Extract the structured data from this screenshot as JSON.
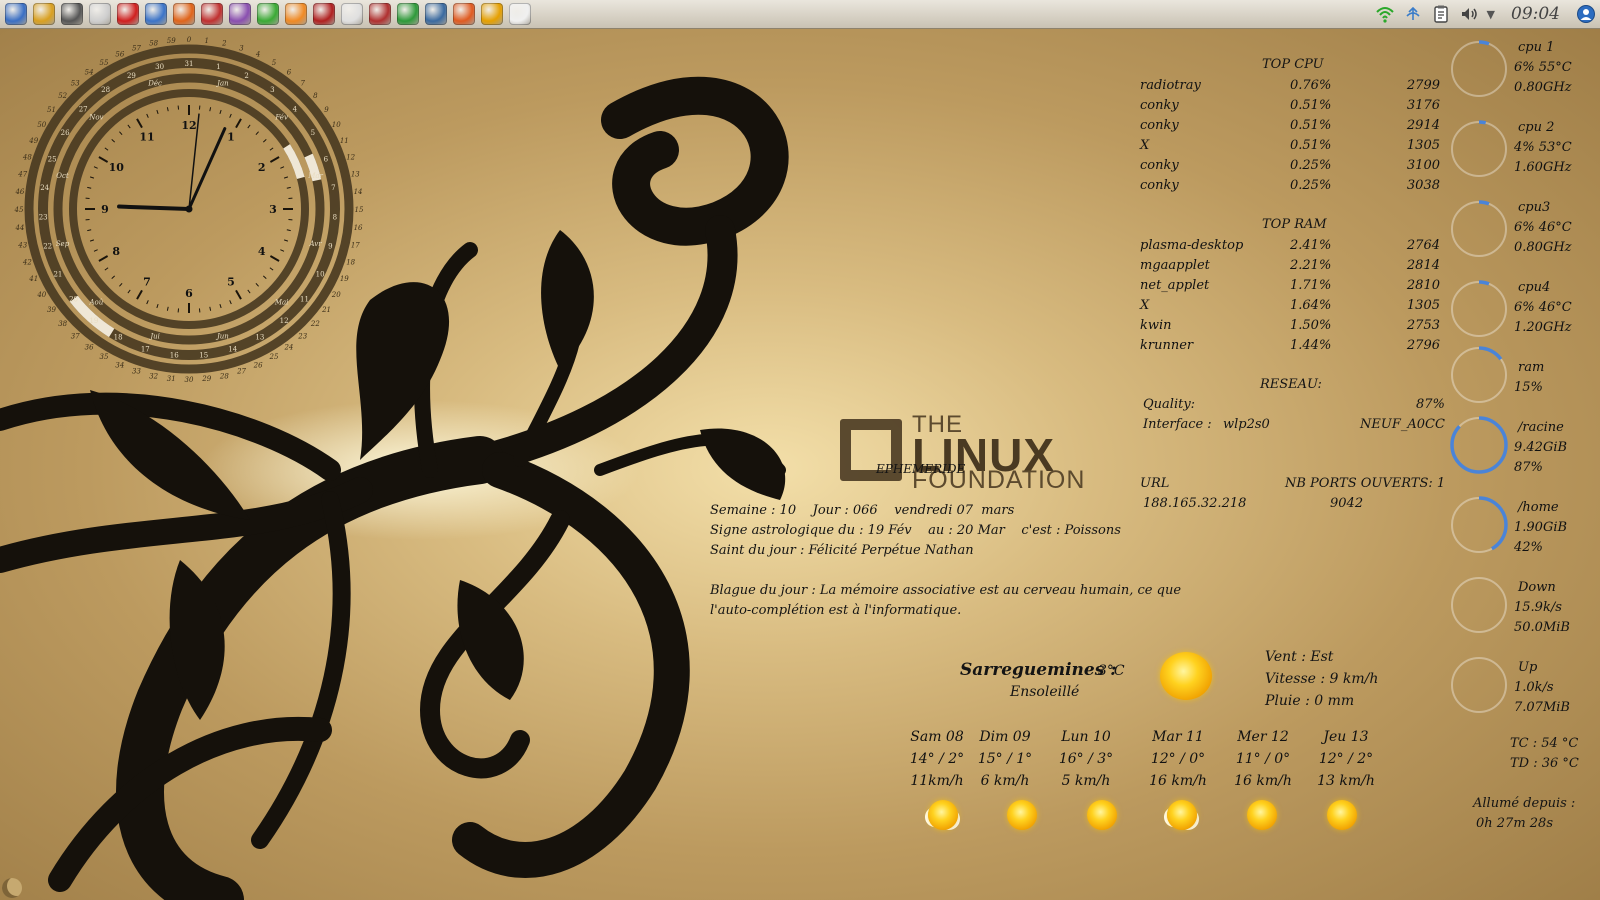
{
  "panel": {
    "clock": "09:04",
    "launchers": [
      {
        "icon": "kde-menu-icon",
        "color": "#3a6fc4"
      },
      {
        "icon": "network-people-icon",
        "color": "#d9a020"
      },
      {
        "icon": "settings-tools-icon",
        "color": "#555555"
      },
      {
        "icon": "file-manager-icon",
        "color": "#cfcfcf"
      },
      {
        "icon": "opera-browser-icon",
        "color": "#d01f1f"
      },
      {
        "icon": "kde-bird-icon",
        "color": "#3c74c8"
      },
      {
        "icon": "firefox-icon",
        "color": "#e0641a"
      },
      {
        "icon": "rss-reader-icon",
        "color": "#c03030"
      },
      {
        "icon": "media-disc-icon",
        "color": "#8a4fb0"
      },
      {
        "icon": "media-player-icon",
        "color": "#3aaa35"
      },
      {
        "icon": "grid-app-icon",
        "color": "#f08a24"
      },
      {
        "icon": "dictionary-icon",
        "color": "#b02020"
      },
      {
        "icon": "phone-app-icon",
        "color": "#e0e0e0"
      },
      {
        "icon": "game-board-icon",
        "color": "#b03030"
      },
      {
        "icon": "spreadsheet-icon",
        "color": "#2e9a3a"
      },
      {
        "icon": "document-icon",
        "color": "#3a6aa0"
      },
      {
        "icon": "presentation-icon",
        "color": "#e05a20"
      },
      {
        "icon": "draw-icon",
        "color": "#e6a000"
      },
      {
        "icon": "text-editor-icon",
        "color": "#f0f0f0"
      }
    ],
    "tray": [
      {
        "icon": "wifi-icon"
      },
      {
        "icon": "network-icon"
      },
      {
        "icon": "clipboard-icon"
      },
      {
        "icon": "volume-icon"
      },
      {
        "icon": "tray-expand-icon"
      }
    ]
  },
  "clock_widget": {
    "hour_numbers": [
      "12",
      "1",
      "2",
      "3",
      "4",
      "5",
      "6",
      "7",
      "8",
      "9",
      "10",
      "11"
    ],
    "months": [
      "Jan",
      "Fév",
      "Mar",
      "Avr",
      "Mai",
      "Jun",
      "Jui",
      "Aoû",
      "Sep",
      "Oct",
      "Nov",
      "Déc"
    ],
    "hour": 9,
    "minute": 4,
    "second": 1
  },
  "top_cpu": {
    "title": "TOP CPU",
    "rows": [
      {
        "name": "radiotray",
        "pct": "0.76%",
        "pid": "2799"
      },
      {
        "name": "conky",
        "pct": "0.51%",
        "pid": "3176"
      },
      {
        "name": "conky",
        "pct": "0.51%",
        "pid": "2914"
      },
      {
        "name": "X",
        "pct": "0.51%",
        "pid": "1305"
      },
      {
        "name": "conky",
        "pct": "0.25%",
        "pid": "3100"
      },
      {
        "name": "conky",
        "pct": "0.25%",
        "pid": "3038"
      }
    ]
  },
  "top_ram": {
    "title": "TOP RAM",
    "rows": [
      {
        "name": "plasma-desktop",
        "pct": "2.41%",
        "pid": "2764"
      },
      {
        "name": "mgaapplet",
        "pct": "2.21%",
        "pid": "2814"
      },
      {
        "name": "net_applet",
        "pct": "1.71%",
        "pid": "2810"
      },
      {
        "name": "X",
        "pct": "1.64%",
        "pid": "1305"
      },
      {
        "name": "kwin",
        "pct": "1.50%",
        "pid": "2753"
      },
      {
        "name": "krunner",
        "pct": "1.44%",
        "pid": "2796"
      }
    ]
  },
  "network": {
    "title": "RESEAU:",
    "quality_label": "Quality:",
    "quality_value": "87%",
    "interface_label": "Interface :",
    "interface_value": "wlp2s0",
    "ssid": "NEUF_A0CC",
    "url_label": "URL",
    "url_value": "188.165.32.218",
    "ports_label": "NB PORTS OUVERTS: 1",
    "ports_value": "9042"
  },
  "meters": [
    {
      "lines": [
        "cpu 1",
        "6% 55°C",
        "0.80GHz"
      ],
      "fill": 0.06
    },
    {
      "lines": [
        "cpu 2",
        "4% 53°C",
        "1.60GHz"
      ],
      "fill": 0.04
    },
    {
      "lines": [
        "cpu3",
        "6% 46°C",
        "0.80GHz"
      ],
      "fill": 0.06
    },
    {
      "lines": [
        "cpu4",
        "6% 46°C",
        "1.20GHz"
      ],
      "fill": 0.06
    },
    {
      "lines": [
        "ram",
        "15%"
      ],
      "fill": 0.15
    },
    {
      "lines": [
        "/racine",
        "9.42GiB",
        "87%"
      ],
      "fill": 0.87
    },
    {
      "lines": [
        "/home",
        "1.90GiB",
        "42%"
      ],
      "fill": 0.42
    },
    {
      "lines": [
        "Down",
        "15.9k/s",
        "50.0MiB"
      ],
      "fill": 0.0
    },
    {
      "lines": [
        "Up",
        "1.0k/s",
        "7.07MiB"
      ],
      "fill": 0.0
    }
  ],
  "temps": {
    "tc": "TC : 54 °C",
    "td": "TD : 36 °C"
  },
  "uptime": {
    "label": "Allumé depuis :",
    "value": "0h 27m 28s"
  },
  "ephemeride": {
    "title": "EPHEMERIDE",
    "line1": "Semaine : 10    Jour : 066    vendredi 07  mars",
    "line2": "Signe astrologique du : 19 Fév    au : 20 Mar    c'est : Poissons",
    "line3": "Saint du jour : Félicité Perpétue Nathan",
    "joke1": "Blague du jour : La mémoire associative est au cerveau humain, ce que",
    "joke2": "l'auto-complétion est à l'informatique."
  },
  "logo": {
    "the": "THE",
    "linux": "LINUX",
    "foundation": "FOUNDATION"
  },
  "weather": {
    "city": "Sarreguemines :",
    "temp": "3°C",
    "condition": "Ensoleillé",
    "wind": "Vent : Est",
    "speed": "Vitesse : 9 km/h",
    "rain": "Pluie : 0 mm",
    "forecast": [
      {
        "day": "Sam 08",
        "temps": "14° / 2°",
        "wind": "11km/h",
        "icon": "sun-cloud-icon"
      },
      {
        "day": "Dim 09",
        "temps": "15° / 1°",
        "wind": "6 km/h",
        "icon": "sun-icon"
      },
      {
        "day": "Lun 10",
        "temps": "16° / 3°",
        "wind": "5 km/h",
        "icon": "sun-icon"
      },
      {
        "day": "Mar 11",
        "temps": "12° / 0°",
        "wind": "16 km/h",
        "icon": "sun-cloud-icon"
      },
      {
        "day": "Mer 12",
        "temps": "11° / 0°",
        "wind": "16 km/h",
        "icon": "sun-icon"
      },
      {
        "day": "Jeu 13",
        "temps": "12° / 2°",
        "wind": "13 km/h",
        "icon": "sun-icon"
      }
    ]
  }
}
